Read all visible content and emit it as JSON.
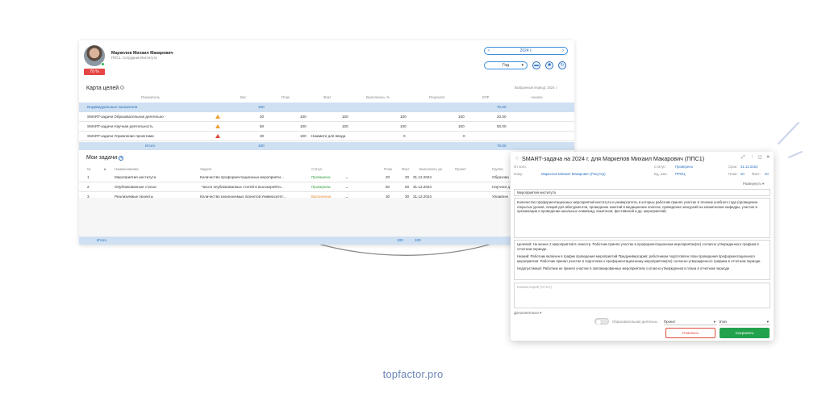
{
  "user": {
    "name": "Маркелов Михаил Макарович",
    "role": "ППС1. Сотрудник Института",
    "kpi_badge": "70 %"
  },
  "period": {
    "label": "2024 г.",
    "prev_icon": "‹",
    "next_icon": "›",
    "view": "Год",
    "dropdown_icon": "▾"
  },
  "toolbar_icons": {
    "chat": "▬",
    "settings": "✱",
    "refresh": "↻"
  },
  "goals": {
    "title": "Карта целей",
    "info": "i",
    "selected_period": "Выбранный период: 2024 г.",
    "headers": [
      "Показатель",
      "Вес",
      "План",
      "Факт",
      "Выполнено, %",
      "Результат",
      "КПР",
      "Анализ"
    ],
    "group": {
      "name": "Индивидуальные показатели",
      "weight": "100",
      "kpr": "70.00"
    },
    "rows": [
      {
        "name": "SMART-задачи Образовательная деятельно",
        "weight": "20",
        "plan": "100",
        "fact": "100",
        "done": "100",
        "result": "100",
        "kpr": "20.00",
        "warn": "orange"
      },
      {
        "name": "SMART-задачи Научная деятельность",
        "weight": "50",
        "plan": "100",
        "fact": "100",
        "done": "100",
        "result": "100",
        "kpr": "50.00",
        "warn": "orange"
      },
      {
        "name": "SMART-задачи Управление проектами",
        "weight": "30",
        "plan": "100",
        "fact": "Нажмите для ввода",
        "done": "0",
        "result": "0",
        "kpr": "",
        "warn": "red"
      }
    ],
    "total": {
      "label": "Итого",
      "weight": "100",
      "kpr": "70.00"
    }
  },
  "tasks": {
    "title": "Мои задачи",
    "add_icon": "+",
    "headers": [
      "№",
      "★",
      "Наименование",
      "Задача",
      "Статус",
      "План",
      "Факт",
      "Выполнить до",
      "Проект",
      "Группа"
    ],
    "rows": [
      {
        "num": "1",
        "name": "Мероприятия института",
        "task": "Количество профориентационных мероприяти...",
        "status": "Проверена",
        "plan": "20",
        "fact": "20",
        "due": "31.12.2024",
        "group": "Образова"
      },
      {
        "num": "2",
        "name": "Опубликованные статьи",
        "task": "Число опубликованных статей в высокорейти...",
        "status": "Проверена",
        "plan": "50",
        "fact": "50",
        "due": "31.12.2024",
        "group": "Научная д"
      },
      {
        "num": "3",
        "name": "Реализуемые проекты",
        "task": "Количество реализуемых проектов Университет...",
        "status": "Выполнена",
        "plan": "30",
        "fact": "30",
        "due": "31.12.2024",
        "group": "Управлен"
      }
    ],
    "total": {
      "label": "Итого",
      "plan": "100",
      "fact": "100"
    }
  },
  "modal": {
    "title": "SMART-задача на 2024 г. для Маркелов Михаил Макарович (ППС1)",
    "icons": {
      "link": "⤢",
      "more": "⋮",
      "expand": "◻",
      "close": "✕"
    },
    "from_label": "От кого:",
    "to_label": "Кому:",
    "to_value": "Маркелов Михаил Макарович (Рекутер)",
    "status_label": "Статус:",
    "status_value": "Проверено",
    "unit_label": "Ед. изм.:",
    "unit_value": "ПРОЦ",
    "due_label": "Срок:",
    "due_value": "31.12.2024",
    "plan_label": "План:",
    "plan_value": "20",
    "fact_label": "Факт:",
    "fact_value": "20",
    "expand_link": "Развернуть ▾",
    "task_name": "Мероприятия института",
    "description": "Количество профориентационных мероприятий института и университета, в которых работник принял участие в течение учебного года (проведение открытых уроков, лекций для абитуриентов, проведение занятий в медицинских классах, проведение экскурсий на клинические кафедры, участие в организации и проведении школьных олимпиад, хакатонов, фестивалей и др. мероприятий)",
    "criteria": [
      "Целевой: Не менее 2 мероприятий в семестр. Работник принял участие в профориентационном мероприятии(ях) согласно утвержденного графика в отчетном периоде.",
      "Низкий: Работник включен в график проведения мероприятий Предуниверсария; работником подготовлен план проведения профориентационного мероприятия. Работник принял участие в подготовке к профориентационному мероприятию(ях) согласно утвержденного графика в отчетном периоде.",
      "Недопустимый: Работник не принял участие в запланированных мероприятиях согласно утвержденного плана в отчетном периоде"
    ],
    "comment_placeholder": "Комментарий (Отчет)",
    "additional": "Дополнительно ▾",
    "edu_label": "Образовательная деятельн...",
    "project_label": "Проект",
    "stage_label": "Этап",
    "cancel": "Отменить",
    "save": "Сохранить"
  },
  "brand": "topfactor.pro",
  "colors": {
    "accent": "#2a6fbd",
    "total_row": "#cfe0f2",
    "save": "#23a24d",
    "cancel": "#e04a3a",
    "badge": "#e64545"
  }
}
